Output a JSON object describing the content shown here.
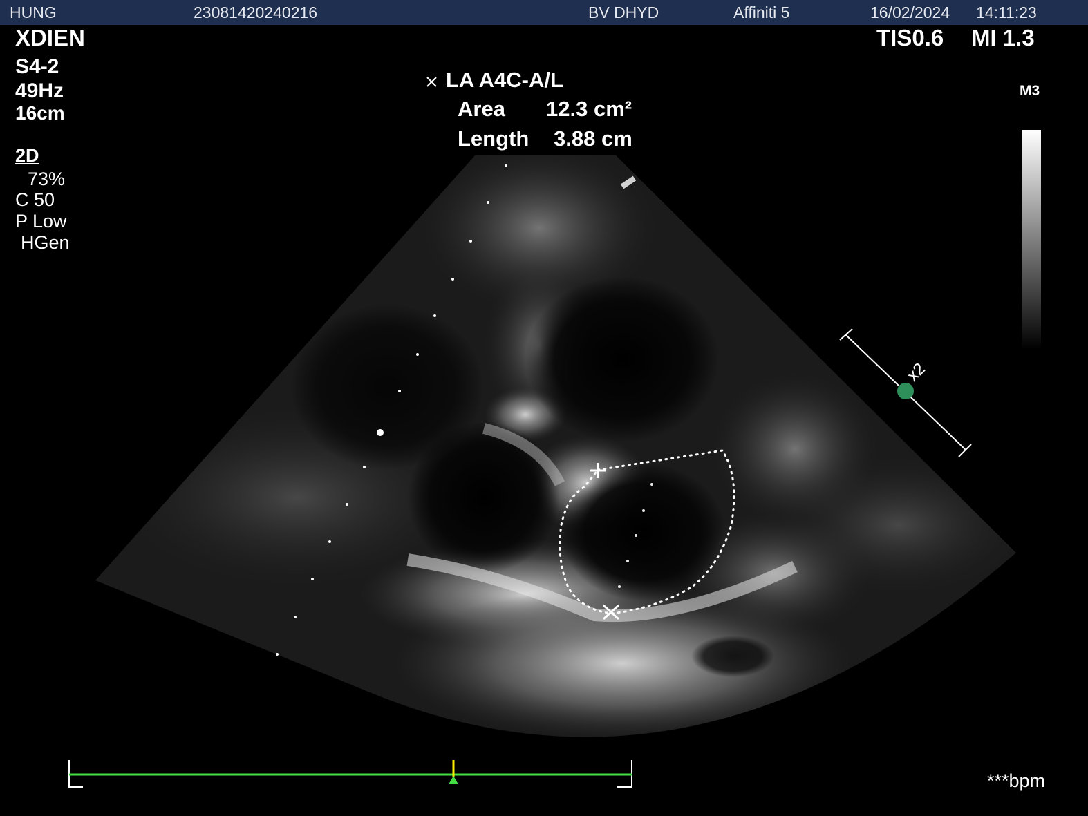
{
  "header": {
    "patient": "HUNG",
    "patient_id": "23081420240216",
    "institution": "BV DHYD",
    "device": "Affiniti 5",
    "date": "16/02/2024",
    "time": "14:11:23"
  },
  "left_panel": {
    "operator": "XDIEN",
    "probe": "S4-2",
    "frame_rate": "49Hz",
    "depth": "16cm",
    "mode": "2D",
    "gain": "73%",
    "compress": "C 50",
    "power": "P Low",
    "freq": "HGen"
  },
  "right_panel": {
    "tis": "TIS0.6",
    "mi": "MI 1.3",
    "map": "M3",
    "heart_rate": "***bpm",
    "zoom_label": "x2"
  },
  "measurement": {
    "title": "LA A4C-A/L",
    "area_label": "Area",
    "area_value": "12.3 cm²",
    "length_label": "Length",
    "length_value": "3.88 cm"
  },
  "colors": {
    "topbar": "#1f2f4f",
    "ecg_line": "#44dd44",
    "ecg_marker": "#ffee00",
    "zoom_handle": "#2f8f5a"
  }
}
